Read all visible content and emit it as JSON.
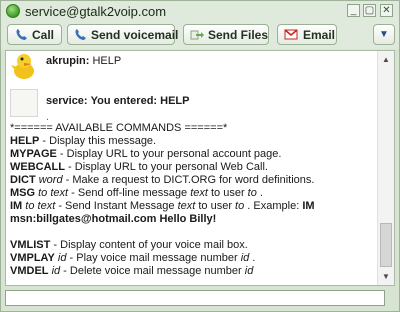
{
  "window": {
    "title": "service@gtalk2voip.com"
  },
  "toolbar": {
    "call_label": "Call",
    "voicemail_label": "Send voicemail",
    "files_label": "Send Files",
    "email_label": "Email"
  },
  "chat": {
    "msg1": {
      "sender": "akrupin:",
      "text": "HELP"
    },
    "msg2": {
      "sender": "service:",
      "text": "You entered: HELP",
      "dot": "."
    },
    "lines": [
      {
        "t": "*====== AVAILABLE COMMANDS ======*"
      },
      {
        "cmd": "HELP",
        "t": " - Display this message."
      },
      {
        "cmd": "MYPAGE",
        "t": " - Display URL to your personal account page."
      },
      {
        "cmd": "WEBCALL",
        "t": " - Display URL to your personal Web Call."
      },
      {
        "cmd": "DICT",
        "arg": "word",
        "t": " - Make a request to DICT.ORG for word definitions."
      },
      {
        "cmd": "MSG",
        "arg": "to text",
        "t1": " - Send off-line message ",
        "arg2": "text",
        "t2": " to user ",
        "arg3": "to",
        "t3": " ."
      },
      {
        "cmd": "IM",
        "arg": "to text",
        "t1": " - Send Instant Message ",
        "arg2": "text",
        "t2": " to user ",
        "arg3": "to",
        "t3": " . Example: ",
        "bold_tail": "IM"
      },
      {
        "bold_full": "msn:billgates@hotmail.com Hello Billy!"
      },
      {
        "gap": true
      },
      {
        "cmd": "VMLIST",
        "t": " - Display content of your voice mail box."
      },
      {
        "cmd": "VMPLAY",
        "arg": "id",
        "t": " - Play voice mail message number ",
        "arg2": "id",
        "t2": " ."
      },
      {
        "cmd": "VMDEL",
        "arg": "id",
        "t": " - Delete voice mail message number ",
        "arg2": "id"
      }
    ]
  },
  "input": {
    "value": ""
  },
  "colors": {
    "frame": "#d7e4d2",
    "accent_email": "#c8231b",
    "chat_bg": "#ffffff"
  }
}
